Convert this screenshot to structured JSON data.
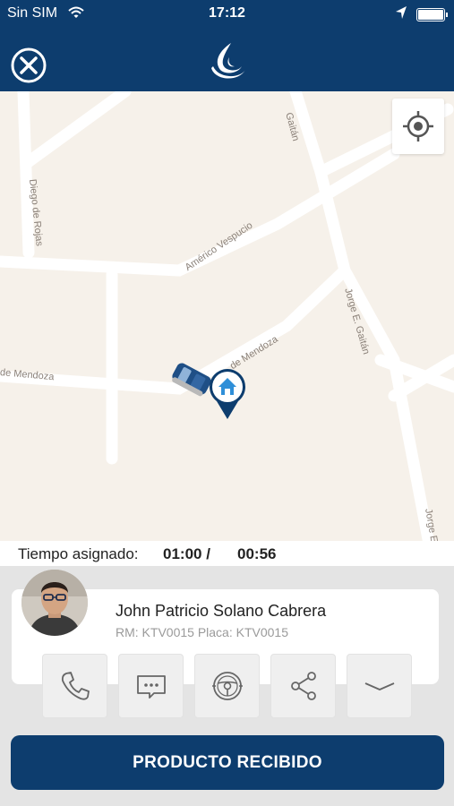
{
  "status_bar": {
    "carrier": "Sin SIM",
    "time": "17:12",
    "wifi_icon": "wifi-icon",
    "location_icon": "location-arrow-icon",
    "battery_icon": "battery-icon"
  },
  "header": {
    "close_icon": "close-circle-icon",
    "logo_icon": "swirl-logo-icon",
    "color": "#0d3d6e"
  },
  "map": {
    "streets": [
      "Gaitán",
      "Diego de Rojas",
      "Américo Vespucio",
      "Jorge E. Gaitán",
      "de Mendoza",
      "de Mendoza",
      "Jorge E"
    ],
    "locate_icon": "crosshair-icon",
    "vehicle_icon": "car-icon",
    "destination_icon": "home-pin-icon"
  },
  "timer": {
    "label": "Tiempo asignado:",
    "total": "01:00 /",
    "remaining": "00:56"
  },
  "driver": {
    "name": "John Patricio Solano Cabrera",
    "details": "RM: KTV0015 Placa: KTV0015"
  },
  "actions": [
    {
      "icon": "phone-icon"
    },
    {
      "icon": "chat-icon"
    },
    {
      "icon": "steering-wheel-icon"
    },
    {
      "icon": "share-icon"
    },
    {
      "icon": "chevron-down-icon"
    }
  ],
  "primary_button": {
    "label": "PRODUCTO RECIBIDO",
    "color": "#0d3d6e"
  }
}
